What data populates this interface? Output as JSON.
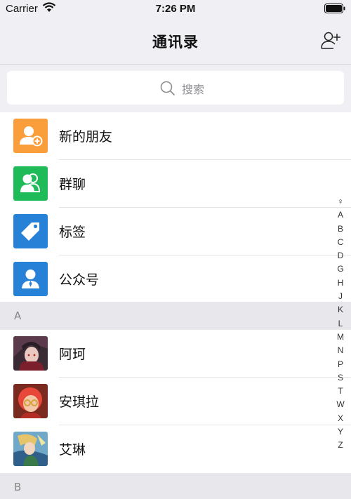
{
  "status_bar": {
    "carrier": "Carrier",
    "time": "7:26 PM"
  },
  "nav": {
    "title": "通讯录"
  },
  "search": {
    "placeholder": "搜索"
  },
  "function_rows": [
    {
      "label": "新的朋友",
      "icon": "new-friend-icon",
      "color": "#fa9d3b"
    },
    {
      "label": "群聊",
      "icon": "group-chat-icon",
      "color": "#1fbb59"
    },
    {
      "label": "标签",
      "icon": "tag-icon",
      "color": "#2782d7"
    },
    {
      "label": "公众号",
      "icon": "official-account-icon",
      "color": "#2782d7"
    }
  ],
  "sections": [
    {
      "header": "A",
      "contacts": [
        {
          "name": "阿珂"
        },
        {
          "name": "安琪拉"
        },
        {
          "name": "艾琳"
        }
      ]
    },
    {
      "header": "B",
      "contacts": []
    }
  ],
  "index_bar": [
    "♀",
    "A",
    "B",
    "C",
    "D",
    "G",
    "H",
    "J",
    "K",
    "L",
    "M",
    "N",
    "P",
    "S",
    "T",
    "W",
    "X",
    "Y",
    "Z"
  ]
}
